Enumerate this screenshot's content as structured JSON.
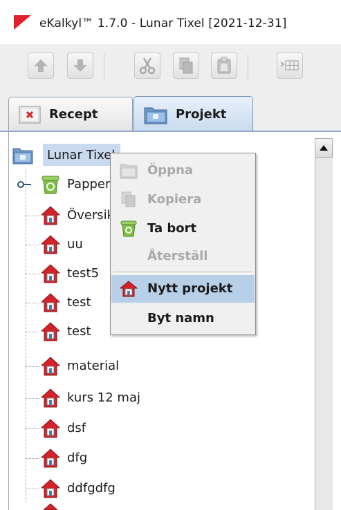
{
  "window": {
    "title": "eKalkyl™ 1.7.0 - Lunar Tixel [2021-12-31]",
    "logo_color": "#e0202a"
  },
  "toolbar": {
    "buttons": [
      {
        "icon": "arrow-up-icon"
      },
      {
        "icon": "arrow-down-icon"
      },
      {
        "icon": "cut-icon"
      },
      {
        "icon": "copy-icon"
      },
      {
        "icon": "paste-icon"
      },
      {
        "icon": "insert-row-icon"
      }
    ]
  },
  "tabs": [
    {
      "label": "Recept",
      "icon": "recept-x-icon",
      "active": false
    },
    {
      "label": "Projekt",
      "icon": "folder-icon",
      "active": true
    }
  ],
  "tree": {
    "root": {
      "label": "Lunar Tixel",
      "icon": "folder-icon"
    },
    "items": [
      {
        "label": "Papperskorg",
        "icon": "trash-icon"
      },
      {
        "label": "Översikt",
        "icon": "house-icon"
      },
      {
        "label": "uu",
        "icon": "house-icon"
      },
      {
        "label": "test5",
        "icon": "house-icon"
      },
      {
        "label": "test",
        "icon": "house-icon"
      },
      {
        "label": "test",
        "icon": "house-icon"
      },
      {
        "label": "material",
        "icon": "house-icon"
      },
      {
        "label": "kurs 12 maj",
        "icon": "house-icon"
      },
      {
        "label": "dsf",
        "icon": "house-icon"
      },
      {
        "label": "dfg",
        "icon": "house-icon"
      },
      {
        "label": "ddfgdfg",
        "icon": "house-icon"
      }
    ]
  },
  "context_menu": {
    "items": [
      {
        "label": "Öppna",
        "enabled": false,
        "icon": "open-icon"
      },
      {
        "label": "Kopiera",
        "enabled": false,
        "icon": "copy-icon"
      },
      {
        "label": "Ta bort",
        "enabled": true,
        "icon": "trash-icon"
      },
      {
        "label": "Återställ",
        "enabled": false,
        "icon": ""
      },
      {
        "label": "Nytt projekt",
        "enabled": true,
        "icon": "house-icon",
        "highlighted": true
      },
      {
        "label": "Byt namn",
        "enabled": true,
        "icon": ""
      }
    ]
  },
  "colors": {
    "selection": "#c9daf0",
    "menu_highlight": "#b8cfe8",
    "house_red": "#d2232a",
    "folder_blue": "#5a86b8"
  }
}
